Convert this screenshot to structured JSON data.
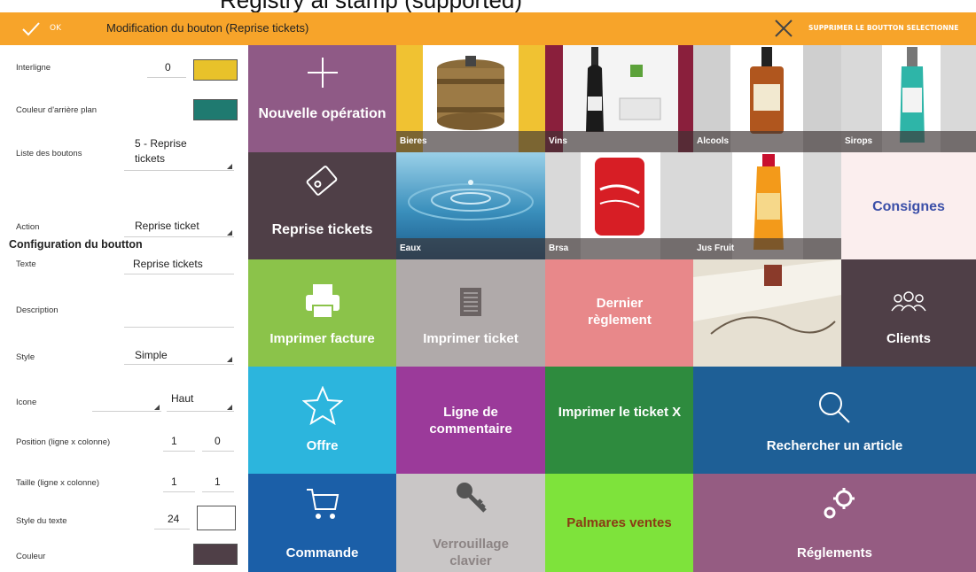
{
  "window": {
    "cropped_text": "Registry ai stamp (supported)"
  },
  "toolbar": {
    "ok_label": "OK",
    "title": "Modification du bouton (Reprise tickets)",
    "delete_label": "SUPPRIMER LE BOUTTON SELECTIONNE",
    "bg_color": "#f7a42a"
  },
  "form": {
    "interligne_label": "Interligne",
    "interligne_value": "0",
    "interligne_color": "#e8c22a",
    "bg_color_label": "Couleur d'arrière plan",
    "bg_color_value": "#1f7a70",
    "button_list_label": "Liste des boutons",
    "button_list_value_1": "5 - Reprise",
    "button_list_value_2": "tickets",
    "section_title": "Configuration du boutton",
    "action_label": "Action",
    "action_value": "Reprise ticket",
    "text_label": "Texte",
    "text_value": "Reprise tickets",
    "description_label": "Description",
    "description_value": "",
    "style_label": "Style",
    "style_value": "Simple",
    "icon_label": "Icone",
    "icon_position_value": "Haut",
    "position_label": "Position (ligne x colonne)",
    "position_row": "1",
    "position_col": "0",
    "size_label": "Taille (ligne x colonne)",
    "size_row": "1",
    "size_col": "1",
    "text_style_label": "Style du texte",
    "text_style_value": "24",
    "color_label": "Couleur",
    "color_value": "#4f3f47"
  },
  "tiles": {
    "nouvelle_operation": "Nouvelle opération",
    "bieres": "Bieres",
    "vins": "Vins",
    "alcools": "Alcools",
    "sirops": "Sirops",
    "reprise_tickets": "Reprise tickets",
    "eaux": "Eaux",
    "brsa": "Brsa",
    "jus_fruit": "Jus Fruit",
    "consignes": "Consignes",
    "imprimer_facture": "Imprimer facture",
    "imprimer_ticket": "Imprimer ticket",
    "dernier_reglement": "Dernier règlement",
    "clients": "Clients",
    "offre": "Offre",
    "ligne_commentaire": "Ligne de commentaire",
    "imprimer_ticket_x": "Imprimer le ticket X",
    "rechercher_article": "Rechercher un article",
    "commande": "Commande",
    "verrouillage_clavier": "Verrouillage clavier",
    "palmares_ventes": "Palmares ventes",
    "reglements": "Réglements"
  },
  "colors": {
    "purple_mauve": "#8f5a86",
    "dark_plum": "#4f3f47",
    "green_light": "#8bc34a",
    "grey": "#b0aaaa",
    "salmon": "#e8888a",
    "teal_blue": "#2cb5dd",
    "purple": "#9b3a9a",
    "dark_green": "#2e8b3e",
    "navy": "#1e5f96",
    "blue": "#1b5fa8",
    "lime": "#7ee33b",
    "rose_mauve": "#955c82",
    "consignes_bg": "#fbeeee",
    "consignes_text": "#3b4fa8",
    "palmares_text": "#8a3a14"
  }
}
